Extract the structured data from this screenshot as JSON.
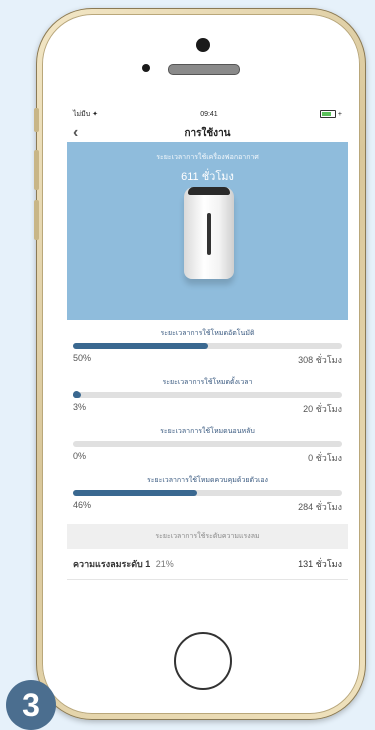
{
  "status_bar": {
    "carrier": "ไม่มีบ ✦",
    "time": "09:41",
    "battery": "+"
  },
  "nav": {
    "title": "การใช้งาน"
  },
  "hero": {
    "caption": "ระยะเวลาการใช้เครื่องฟอกอากาศ",
    "total": "611 ชั่วโมง"
  },
  "usage": [
    {
      "title": "ระยะเวลาการใช้โหมดอัตโนมัติ",
      "percent": "50%",
      "hours": "308 ชั่วโมง",
      "fraction": 0.5
    },
    {
      "title": "ระยะเวลาการใช้โหมดตั้งเวลา",
      "percent": "3%",
      "hours": "20 ชั่วโมง",
      "fraction": 0.03
    },
    {
      "title": "ระยะเวลาการใช้โหมดนอนหลับ",
      "percent": "0%",
      "hours": "0 ชั่วโมง",
      "fraction": 0.0
    },
    {
      "title": "ระยะเวลาการใช้โหมดควบคุมด้วยตัวเอง",
      "percent": "46%",
      "hours": "284 ชั่วโมง",
      "fraction": 0.46
    }
  ],
  "levels": {
    "header": "ระยะเวลาการใช้ระดับความแรงลม",
    "rows": [
      {
        "name": "ความแรงลมระดับ 1",
        "percent": "21%",
        "hours": "131 ชั่วโมง"
      }
    ]
  },
  "badge": {
    "label": "3"
  },
  "colors": {
    "hero": "#8fbcdc",
    "bar": "#3a6890",
    "badge": "#4b6e8f"
  }
}
